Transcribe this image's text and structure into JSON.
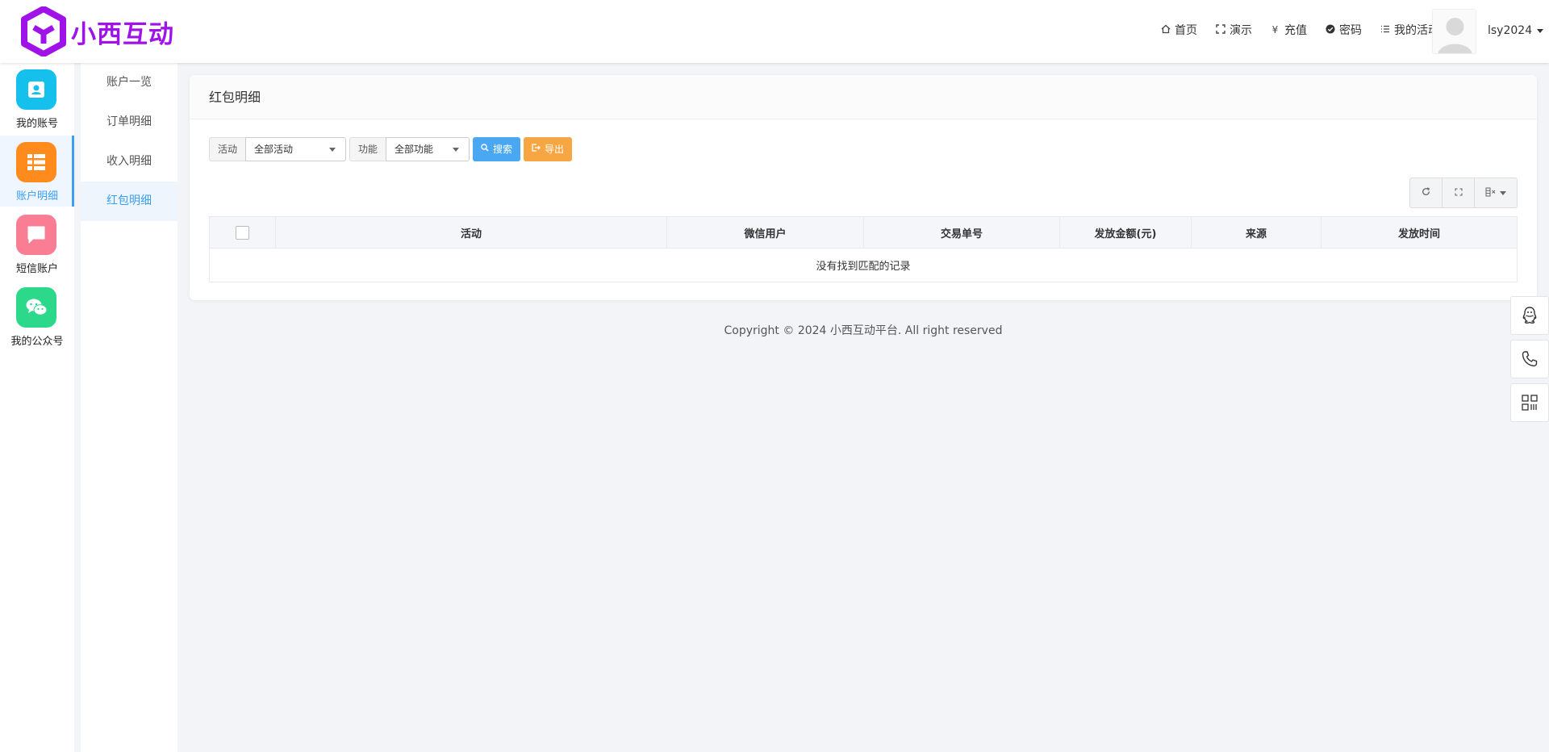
{
  "brand": {
    "name": "小西互动",
    "color": "#a013e8"
  },
  "topnav": [
    {
      "icon": "home-icon",
      "label": "首页"
    },
    {
      "icon": "expand-icon",
      "label": "演示"
    },
    {
      "icon": "yen-icon",
      "label": "充值"
    },
    {
      "icon": "check-circle-icon",
      "label": "密码"
    },
    {
      "icon": "list-icon",
      "label": "我的活动"
    }
  ],
  "user": {
    "name": "lsy2024"
  },
  "iconbar": [
    {
      "label": "我的账号",
      "icon": "account-card-icon",
      "color": "#16c0ec"
    },
    {
      "label": "账户明细",
      "icon": "list-grid-icon",
      "color": "#ff8b1d",
      "active": true
    },
    {
      "label": "短信账户",
      "icon": "message-icon",
      "color": "#f97e93"
    },
    {
      "label": "我的公众号",
      "icon": "wechat-icon",
      "color": "#2cd98a"
    }
  ],
  "subbar": [
    {
      "label": "账户一览"
    },
    {
      "label": "订单明细"
    },
    {
      "label": "收入明细"
    },
    {
      "label": "红包明细",
      "active": true
    }
  ],
  "card": {
    "title": "红包明细",
    "filters": {
      "activity_label": "活动",
      "activity_value": "全部活动",
      "function_label": "功能",
      "function_value": "全部功能",
      "search_label": "搜索",
      "export_label": "导出"
    },
    "table": {
      "columns": [
        "活动",
        "微信用户",
        "交易单号",
        "发放金额(元)",
        "来源",
        "发放时间"
      ],
      "empty_text": "没有找到匹配的记录"
    }
  },
  "footer": {
    "text": "Copyright © 2024 小西互动平台. All right reserved"
  }
}
